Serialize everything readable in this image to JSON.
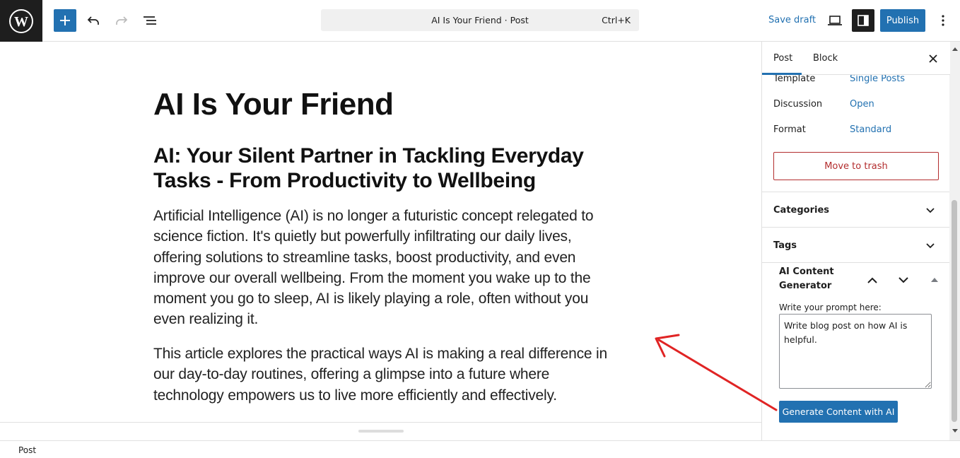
{
  "toolbar": {
    "command_title": "AI Is Your Friend · Post",
    "command_shortcut": "Ctrl+K",
    "save_draft": "Save draft",
    "publish": "Publish"
  },
  "post": {
    "title": "AI Is Your Friend",
    "heading": "AI: Your Silent Partner in Tackling Everyday Tasks - From Productivity to Wellbeing",
    "paragraphs": [
      "Artificial Intelligence (AI) is no longer a futuristic concept relegated to science fiction. It's quietly but powerfully infiltrating our daily lives, offering solutions to streamline tasks, boost productivity, and even improve our overall wellbeing. From the moment you wake up to the moment you go to sleep, AI is likely playing a role, often without you even realizing it.",
      "This article explores the practical ways AI is making a real difference in our day-to-day routines, offering a glimpse into a future where technology empowers us to live more efficiently and effectively."
    ]
  },
  "sidebar": {
    "tabs": [
      "Post",
      "Block"
    ],
    "meta": [
      {
        "label": "Template",
        "value": "Single Posts"
      },
      {
        "label": "Discussion",
        "value": "Open"
      },
      {
        "label": "Format",
        "value": "Standard"
      }
    ],
    "trash": "Move to trash",
    "panels": [
      "Categories",
      "Tags"
    ],
    "ai": {
      "title": "AI Content Generator",
      "prompt_label": "Write your prompt here:",
      "prompt_value": "Write blog post on how AI is helpful.",
      "generate": "Generate Content with AI"
    }
  },
  "footer": {
    "breadcrumb": "Post"
  },
  "colors": {
    "accent": "#2271b1",
    "danger": "#b32d2e",
    "annotation": "#e02424"
  }
}
